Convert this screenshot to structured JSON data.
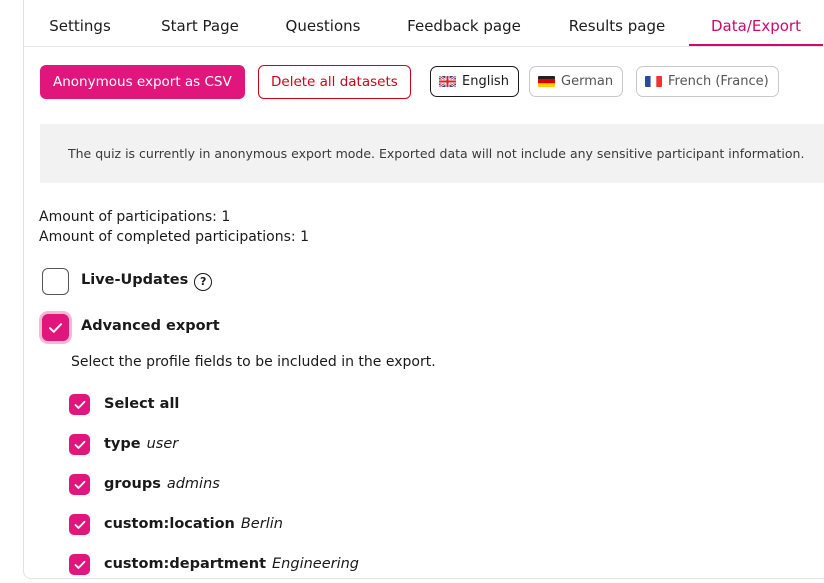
{
  "tabs": [
    {
      "label": "Settings"
    },
    {
      "label": "Start Page"
    },
    {
      "label": "Questions"
    },
    {
      "label": "Feedback page"
    },
    {
      "label": "Results page"
    },
    {
      "label": "Data/Export"
    }
  ],
  "active_tab": "Data/Export",
  "toolbar": {
    "export_csv_label": "Anonymous export as CSV",
    "delete_label": "Delete all datasets"
  },
  "languages": [
    {
      "label": "English",
      "flag": "uk-flag-icon",
      "active": true
    },
    {
      "label": "German",
      "flag": "germany-flag-icon",
      "active": false
    },
    {
      "label": "French (France)",
      "flag": "france-flag-icon",
      "active": false
    }
  ],
  "notice": "The quiz is currently in anonymous export mode. Exported data will not include any sensitive participant information.",
  "stats": {
    "participations": "Amount of participations:  1",
    "completed": "Amount of completed participations:  1"
  },
  "live_updates": {
    "label": "Live-Updates",
    "checked": false,
    "help_icon": "question-circle-icon",
    "help_glyph": "?"
  },
  "advanced_export": {
    "label": "Advanced export",
    "checked": true
  },
  "profile_fields": {
    "description": "Select the profile fields to be included in the export.",
    "select_all": "Select all",
    "fields": [
      {
        "name": "type",
        "value": "user",
        "checked": true
      },
      {
        "name": "groups",
        "value": "admins",
        "checked": true
      },
      {
        "name": "custom:location",
        "value": "Berlin",
        "checked": true
      },
      {
        "name": "custom:department",
        "value": "Engineering",
        "checked": true
      }
    ]
  },
  "colors": {
    "accent": "#e0167c",
    "danger": "#d0021b",
    "notice_bg": "#f2f2f2"
  }
}
